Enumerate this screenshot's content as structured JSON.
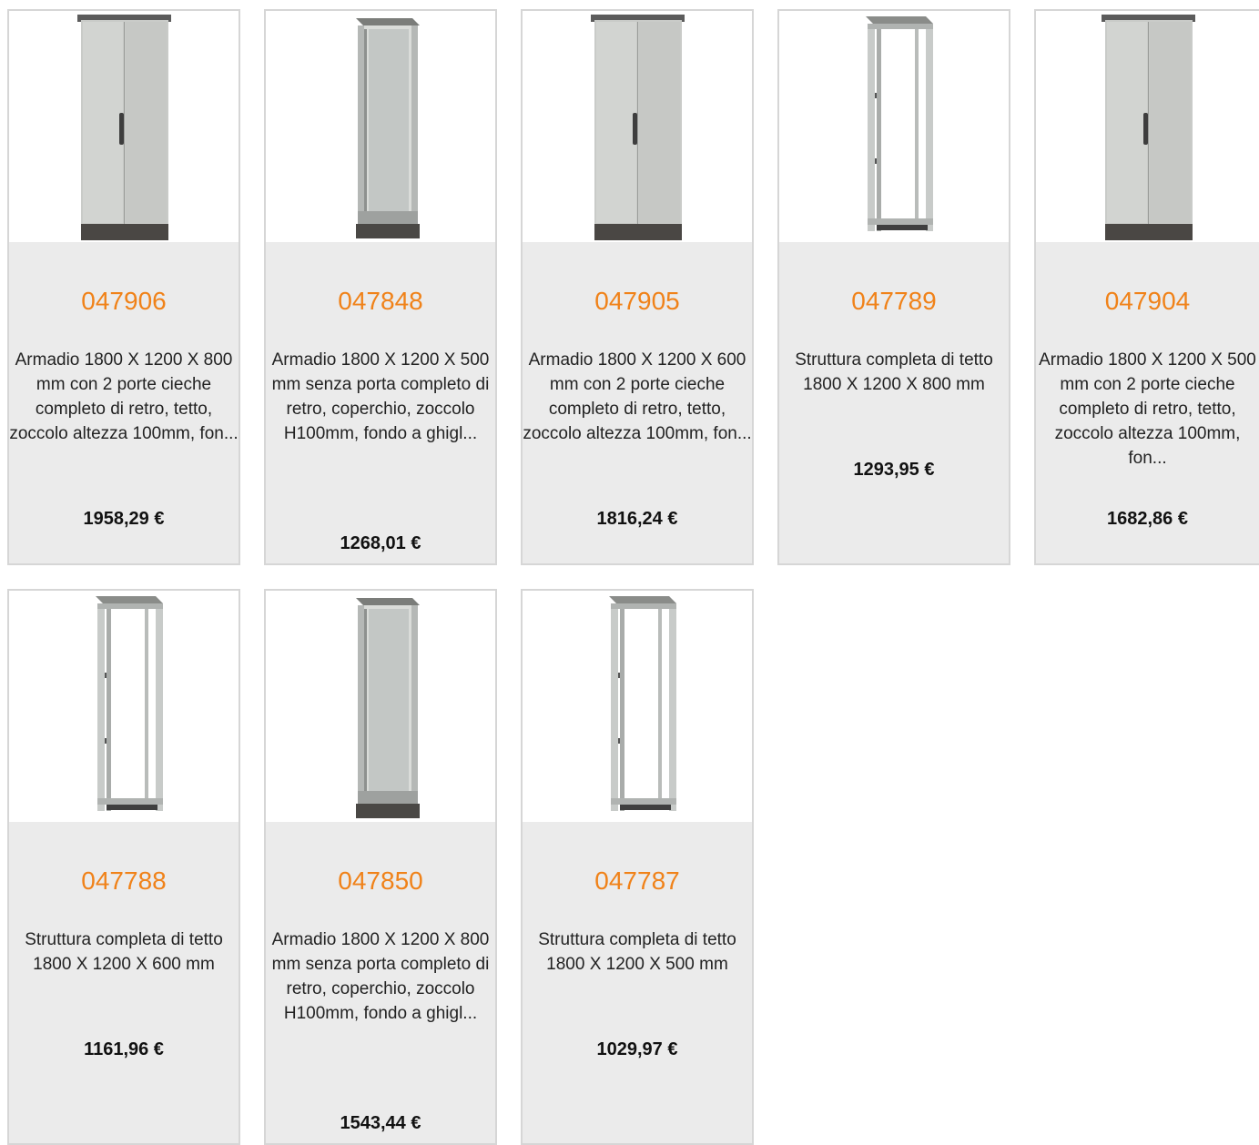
{
  "products": [
    {
      "code": "047906",
      "description": "Armadio 1800 X 1200 X 800 mm con 2 porte cieche completo di retro, tetto, zoccolo altezza 100mm, fon...",
      "price": "1958,29 €",
      "image": "closed-cabinet-icon"
    },
    {
      "code": "047848",
      "description": "Armadio 1800 X 1200 X 500 mm senza porta completo di retro, coperchio, zoccolo H100mm, fondo a ghigl...",
      "price": "1268,01 €",
      "image": "open-cabinet-with-back-icon"
    },
    {
      "code": "047905",
      "description": "Armadio 1800 X 1200 X 600 mm con 2 porte cieche completo di retro, tetto, zoccolo altezza 100mm, fon...",
      "price": "1816,24 €",
      "image": "closed-cabinet-icon"
    },
    {
      "code": "047789",
      "description": "Struttura completa di tetto 1800 X 1200 X 800 mm",
      "price": "1293,95 €",
      "image": "frame-structure-icon"
    },
    {
      "code": "047904",
      "description": "Armadio 1800 X 1200 X 500 mm con 2 porte cieche completo di retro, tetto, zoccolo altezza 100mm, fon...",
      "price": "1682,86 €",
      "image": "closed-cabinet-icon"
    },
    {
      "code": "047788",
      "description": "Struttura completa di tetto 1800 X 1200 X 600 mm",
      "price": "1161,96 €",
      "image": "frame-structure-icon"
    },
    {
      "code": "047850",
      "description": "Armadio 1800 X 1200 X 800 mm senza porta completo di retro, coperchio, zoccolo H100mm, fondo a ghigl...",
      "price": "1543,44 €",
      "image": "open-cabinet-with-back-icon"
    },
    {
      "code": "047787",
      "description": "Struttura completa di tetto 1800 X 1200 X 500 mm",
      "price": "1029,97 €",
      "image": "frame-structure-icon"
    }
  ],
  "colors": {
    "accent": "#f08219",
    "card_background": "#ebebeb",
    "card_border": "#d6d6d6"
  }
}
